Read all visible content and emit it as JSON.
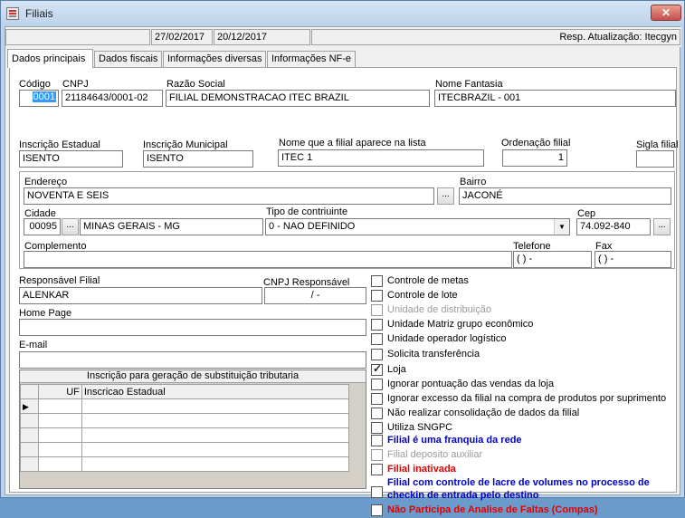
{
  "window": {
    "title": "Filiais",
    "close_label": "✕"
  },
  "status": {
    "date1": "27/02/2017",
    "date2": "20/12/2017",
    "resp": "Resp. Atualização: Itecgyn"
  },
  "tabs": [
    "Dados principais",
    "Dados fiscais",
    "Informações diversas",
    "Informações NF-e"
  ],
  "form": {
    "codigo": {
      "label": "Código",
      "value": "0001"
    },
    "cnpj": {
      "label": "CNPJ",
      "value": "21184643/0001-02"
    },
    "razao": {
      "label": "Razão Social",
      "value": "FILIAL DEMONSTRACAO ITEC BRAZIL"
    },
    "fantasia": {
      "label": "Nome Fantasia",
      "value": "ITECBRAZIL - 001"
    },
    "ie": {
      "label": "Inscrição Estadual",
      "value": "ISENTO"
    },
    "im": {
      "label": "Inscrição Municipal",
      "value": "ISENTO"
    },
    "nome_lista": {
      "label": "Nome que a filial aparece na lista",
      "value": "ITEC 1"
    },
    "ordenacao": {
      "label": "Ordenação filial",
      "value": "1"
    },
    "sigla": {
      "label": "Sigla filial",
      "value": ""
    },
    "endereco": {
      "label": "Endereço",
      "value": "NOVENTA E SEIS"
    },
    "bairro": {
      "label": "Bairro",
      "value": "JACONÉ"
    },
    "cidade": {
      "label": "Cidade",
      "code": "00095",
      "value": "MINAS GERAIS - MG"
    },
    "tipo_contribuinte": {
      "label": "Tipo de contriuinte",
      "value": "0 - NAO DEFINIDO"
    },
    "cep": {
      "label": "Cep",
      "value": "74.092-840"
    },
    "complemento": {
      "label": "Complemento",
      "value": ""
    },
    "telefone": {
      "label": "Telefone",
      "value": "( )   -"
    },
    "fax": {
      "label": "Fax",
      "value": "( )   -"
    },
    "responsavel": {
      "label": "Responsável Filial",
      "value": "ALENKAR"
    },
    "cnpj_resp": {
      "label": "CNPJ Responsável",
      "value": "  /   -"
    },
    "homepage": {
      "label": "Home Page",
      "value": ""
    },
    "email": {
      "label": "E-mail",
      "value": ""
    },
    "ellipsis": "..."
  },
  "grid": {
    "title": "Inscrição para geração de substituição tributaria",
    "col_uf": "UF",
    "col_ie": "Inscricao Estadual",
    "row_indicator": "▶"
  },
  "checkboxes": [
    {
      "label": "Controle de metas",
      "checked": false,
      "style": "normal"
    },
    {
      "label": "Controle de lote",
      "checked": false,
      "style": "normal"
    },
    {
      "label": "Unidade de distribuição",
      "checked": false,
      "style": "disabled"
    },
    {
      "label": "Unidade Matriz grupo econômico",
      "checked": false,
      "style": "normal"
    },
    {
      "label": "Unidade operador logístico",
      "checked": false,
      "style": "normal"
    },
    {
      "label": "Solicita transferência",
      "checked": false,
      "style": "normal"
    },
    {
      "label": "Loja",
      "checked": true,
      "style": "normal"
    },
    {
      "label": "Ignorar pontuação das vendas da loja",
      "checked": false,
      "style": "normal"
    },
    {
      "label": "Ignorar excesso da filial na compra de produtos por suprimento",
      "checked": false,
      "style": "normal"
    },
    {
      "label": "Não realizar consolidação de dados da filial",
      "checked": false,
      "style": "normal"
    },
    {
      "label": "Utiliza SNGPC",
      "checked": false,
      "style": "normal"
    },
    {
      "label": "Filial é uma franquia da rede",
      "checked": false,
      "style": "blue"
    },
    {
      "label": "Filial deposito auxiliar",
      "checked": false,
      "style": "disabled"
    },
    {
      "label": "Filial inativada",
      "checked": false,
      "style": "red"
    },
    {
      "label": "Filial com controle de lacre de volumes no processo de checkin de entrada pelo destino",
      "checked": false,
      "style": "blue"
    },
    {
      "label": "Não Participa de Analise de Faltas (Compas)",
      "checked": false,
      "style": "red"
    }
  ],
  "colors": {
    "blue": "#0000c0",
    "red": "#e00000",
    "disabled": "#9a9a9a",
    "selection": "#3399ff"
  }
}
